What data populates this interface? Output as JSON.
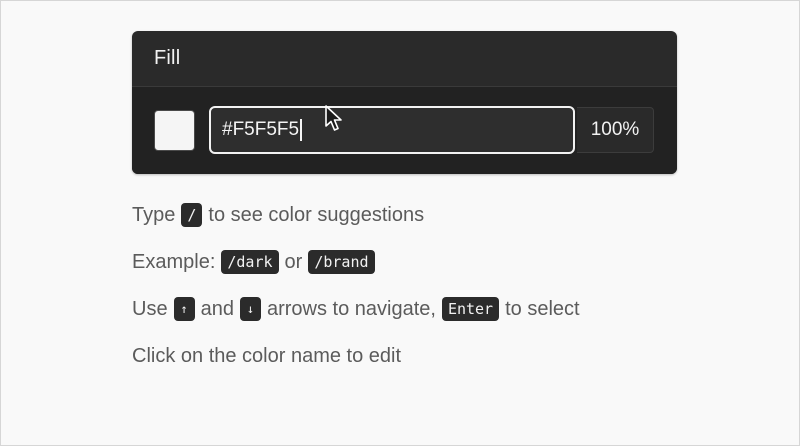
{
  "panel": {
    "title": "Fill",
    "swatch_color": "#F5F5F5",
    "hex_value": "#F5F5F5",
    "opacity": "100%"
  },
  "hints": {
    "line1": {
      "before": "Type",
      "key": "/",
      "after": "to see color suggestions"
    },
    "line2": {
      "before": "Example:",
      "key1": "/dark",
      "mid": "or",
      "key2": "/brand"
    },
    "line3": {
      "before": "Use",
      "key1": "↑",
      "mid1": "and",
      "key2": "↓",
      "mid2": "arrows to navigate,",
      "key3": "Enter",
      "after": "to select"
    },
    "line4": {
      "text": "Click on the color name to edit"
    }
  },
  "icons": {
    "cursor": "mouse-pointer-icon"
  }
}
